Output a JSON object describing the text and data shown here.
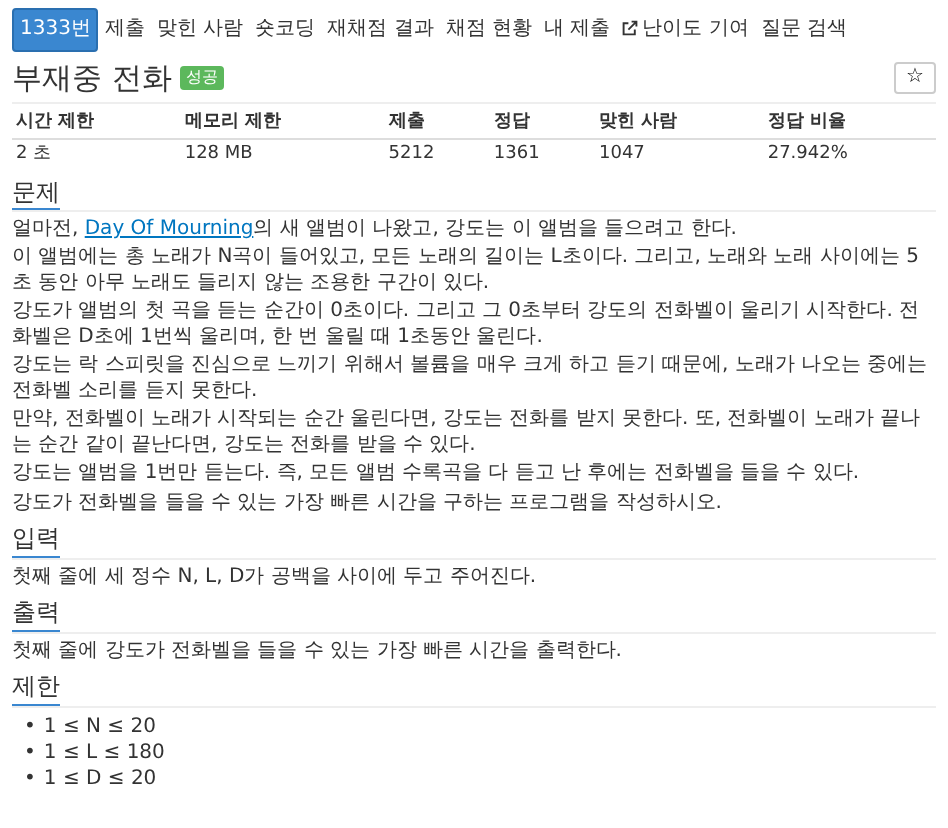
{
  "nav_tabs": [
    {
      "label": "1333번",
      "selected": true,
      "external": false
    },
    {
      "label": "제출",
      "selected": false,
      "external": false
    },
    {
      "label": "맞힌 사람",
      "selected": false,
      "external": false
    },
    {
      "label": "숏코딩",
      "selected": false,
      "external": false
    },
    {
      "label": "재채점 결과",
      "selected": false,
      "external": false
    },
    {
      "label": "채점 현황",
      "selected": false,
      "external": false
    },
    {
      "label": "내 제출",
      "selected": false,
      "external": false
    },
    {
      "label": "난이도 기여",
      "selected": false,
      "external": true
    },
    {
      "label": "질문 검색",
      "selected": false,
      "external": false
    }
  ],
  "title": "부재중 전화",
  "title_badge": "성공",
  "star_button": "☆",
  "info_table": {
    "columns": [
      "시간 제한",
      "메모리 제한",
      "제출",
      "정답",
      "맞힌 사람",
      "정답 비율"
    ],
    "rows": [
      [
        "2 초",
        "128 MB",
        "5212",
        "1361",
        "1047",
        "27.942%"
      ]
    ]
  },
  "sections": [
    {
      "heading": "문제",
      "kind": "text",
      "paragraphs": [
        {
          "parts": [
            {
              "text": "얼마전, "
            },
            {
              "text": "Day Of Mourning",
              "kind": "link"
            },
            {
              "text": "의 새 앨범이 나왔고, 강도는 이 앨범을 들으려고 한다."
            }
          ]
        },
        {
          "parts": [
            {
              "text": "이 앨범에는 총 노래가 N곡이 들어있고, 모든 노래의 길이는 L초이다. 그리고, 노래와 노래 사이에는 5초 동안 아무 노래도 들리지 않는 조용한 구간이 있다."
            }
          ]
        },
        {
          "parts": [
            {
              "text": "강도가 앨범의 첫 곡을 듣는 순간이 0초이다. 그리고 그 0초부터 강도의 전화벨이 울리기 시작한다. 전화벨은 D초에 1번씩 울리며, 한 번 울릴 때 1초동안 울린다."
            }
          ]
        },
        {
          "parts": [
            {
              "text": "강도는 락 스피릿을 진심으로 느끼기 위해서 볼륨을 매우 크게 하고 듣기 때문에, 노래가 나오는 중에는 전화벨 소리를 듣지 못한다."
            }
          ]
        },
        {
          "parts": [
            {
              "text": "만약, 전화벨이 노래가 시작되는 순간 울린다면, 강도는 전화를 받지 못한다. 또, 전화벨이 노래가 끝나는 순간 같이 끝난다면, 강도는 전화를 받을 수 있다."
            }
          ]
        },
        {
          "parts": [
            {
              "text": "강도는 앨범을 1번만 듣는다. 즉, 모든 앨범 수록곡을 다 듣고 난 후에는 전화벨을 들을 수 있다."
            }
          ]
        },
        {
          "parts": [
            {
              "text": "강도가 전화벨을 들을 수 있는 가장 빠른 시간을 구하는 프로그램을 작성하시오."
            }
          ]
        }
      ]
    },
    {
      "heading": "입력",
      "kind": "text",
      "paragraphs": [
        {
          "parts": [
            {
              "text": "첫째 줄에 세 정수 N, L, D가 공백을 사이에 두고 주어진다."
            }
          ]
        }
      ]
    },
    {
      "heading": "출력",
      "kind": "text",
      "paragraphs": [
        {
          "parts": [
            {
              "text": "첫째 줄에 강도가 전화벨을 들을 수 있는 가장 빠른 시간을 출력한다."
            }
          ]
        }
      ]
    },
    {
      "heading": "제한",
      "kind": "list",
      "items": [
        {
          "bullet": "•",
          "text": "1 ≤ N ≤ 20"
        },
        {
          "bullet": "•",
          "text": "1 ≤ L ≤ 180"
        },
        {
          "bullet": "•",
          "text": "1 ≤ D ≤ 20"
        }
      ]
    }
  ]
}
